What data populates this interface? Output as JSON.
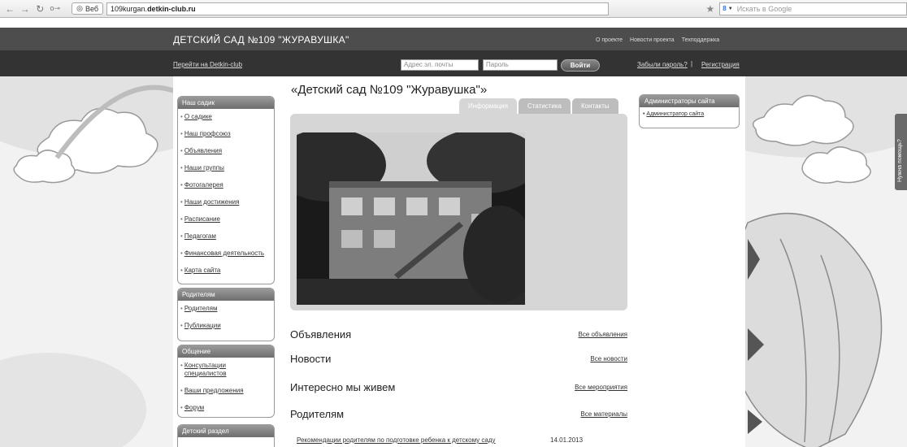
{
  "browser": {
    "back_icon": "arrow-left-icon",
    "forward_icon": "arrow-right-icon",
    "reload_icon": "reload-icon",
    "key_icon": "key-icon",
    "tab_label": "Веб",
    "url_prefix": "109kurgan.",
    "url_domain": "detkin-club.ru",
    "search_placeholder": "Искать в Google"
  },
  "header": {
    "site_title": "ДЕТСКИЙ САД №109 \"ЖУРАВУШКА\"",
    "links": [
      "О проекте",
      "Новости проекта",
      "Техподдержка"
    ]
  },
  "login": {
    "go_detkin": "Перейти на Detkin-club",
    "email_placeholder": "Адрес эл. почты",
    "password_placeholder": "Пароль",
    "submit": "Войти",
    "forgot": "Забыли пароль?",
    "separator": "|",
    "register": "Регистрация"
  },
  "sidebar": {
    "our_kindergarten": {
      "title": "Наш садик",
      "items": [
        "О садике",
        "Наш профсоюз",
        "Объявления",
        "Наши группы",
        "Фотогалерея",
        "Наши достижения",
        "Расписание",
        "Педагогам",
        "Финансовая деятельность",
        "Карта сайта"
      ]
    },
    "parents": {
      "title": "Родителям",
      "items": [
        "Родителям",
        "Публикации"
      ]
    },
    "communication": {
      "title": "Общение",
      "items": [
        "Консультации специалистов",
        "Ваши предложения",
        "Форум"
      ]
    },
    "kids": {
      "title": "Детский раздел"
    }
  },
  "main": {
    "heading": "«Детский сад №109 \"Журавушка\"»",
    "tabs": [
      "Информация",
      "Статистика",
      "Контакты"
    ],
    "sections": [
      {
        "title": "Объявления",
        "link": "Все объявления"
      },
      {
        "title": "Новости",
        "link": "Все новости"
      },
      {
        "title": "Интересно мы живем",
        "link": "Все мероприятия"
      },
      {
        "title": "Родителям",
        "link": "Все материалы"
      }
    ],
    "news": {
      "title": "Рекомендации родителям по подготовке ребенка к детскому саду",
      "date": "14.01.2013"
    }
  },
  "admins": {
    "title": "Администраторы сайта",
    "item": "Администратор сайта"
  },
  "help_tab": "Нужна помощь?",
  "colors": {
    "header_bg": "#4d4d4d",
    "login_bar_bg": "#333333",
    "panel_bg": "#d6d6d6"
  }
}
